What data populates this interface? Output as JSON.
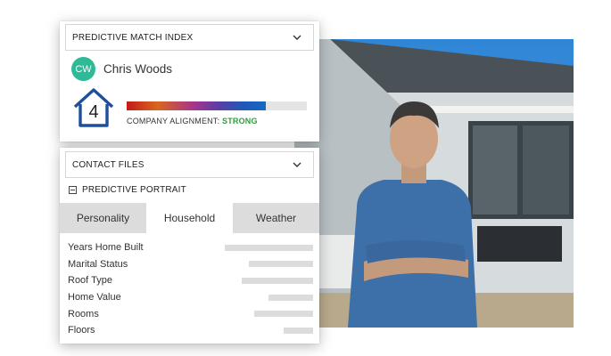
{
  "match_panel": {
    "dropdown_label": "PREDICTIVE MATCH INDEX",
    "person": {
      "initials": "CW",
      "name": "Chris Woods",
      "avatar_color": "#2fb996"
    },
    "score": "4",
    "alignment_progress": 0.77,
    "alignment_prefix": "COMPANY ALIGNMENT:",
    "alignment_value": "STRONG",
    "alignment_color": "#2e9c3a",
    "house_color": "#1d4f9c"
  },
  "contact_panel": {
    "dropdown_label": "CONTACT FILES",
    "section_label": "PREDICTIVE PORTRAIT",
    "tabs": [
      {
        "label": "Personality",
        "active": false
      },
      {
        "label": "Household",
        "active": true
      },
      {
        "label": "Weather",
        "active": false
      }
    ],
    "rows": [
      {
        "label": "Years Home Built",
        "fill": 0.36
      },
      {
        "label": "Marital Status",
        "fill": 0.26
      },
      {
        "label": "Roof Type",
        "fill": 0.29
      },
      {
        "label": "Home Value",
        "fill": 0.18
      },
      {
        "label": "Rooms",
        "fill": 0.24
      },
      {
        "label": "Floors",
        "fill": 0.12
      }
    ]
  },
  "icons": {
    "chevron": "chevron-down-icon",
    "house": "house-icon",
    "collapse": "minus-square-icon"
  }
}
